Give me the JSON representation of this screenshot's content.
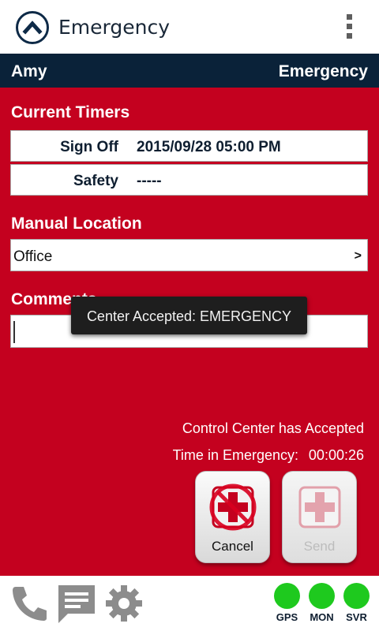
{
  "appbar": {
    "title": "Emergency"
  },
  "namebar": {
    "user": "Amy",
    "mode": "Emergency"
  },
  "timers": {
    "title": "Current Timers",
    "rows": [
      {
        "label": "Sign Off",
        "value": "2015/09/28 05:00 PM"
      },
      {
        "label": "Safety",
        "value": "-----"
      }
    ]
  },
  "location": {
    "title": "Manual Location",
    "value": "Office",
    "chevron": ">"
  },
  "comments": {
    "title": "Comments",
    "value": ""
  },
  "toast": {
    "message": "Center Accepted: EMERGENCY"
  },
  "status": {
    "accepted_text": "Control Center has Accepted",
    "time_label": "Time in Emergency:",
    "time_value": "00:00:26"
  },
  "buttons": {
    "cancel_label": "Cancel",
    "send_label": "Send"
  },
  "indicators": [
    {
      "label": "GPS",
      "color": "#1ec91e"
    },
    {
      "label": "MON",
      "color": "#1ec91e"
    },
    {
      "label": "SVR",
      "color": "#1ec91e"
    }
  ],
  "icons": [
    "phone-icon",
    "message-icon",
    "gear-icon"
  ]
}
